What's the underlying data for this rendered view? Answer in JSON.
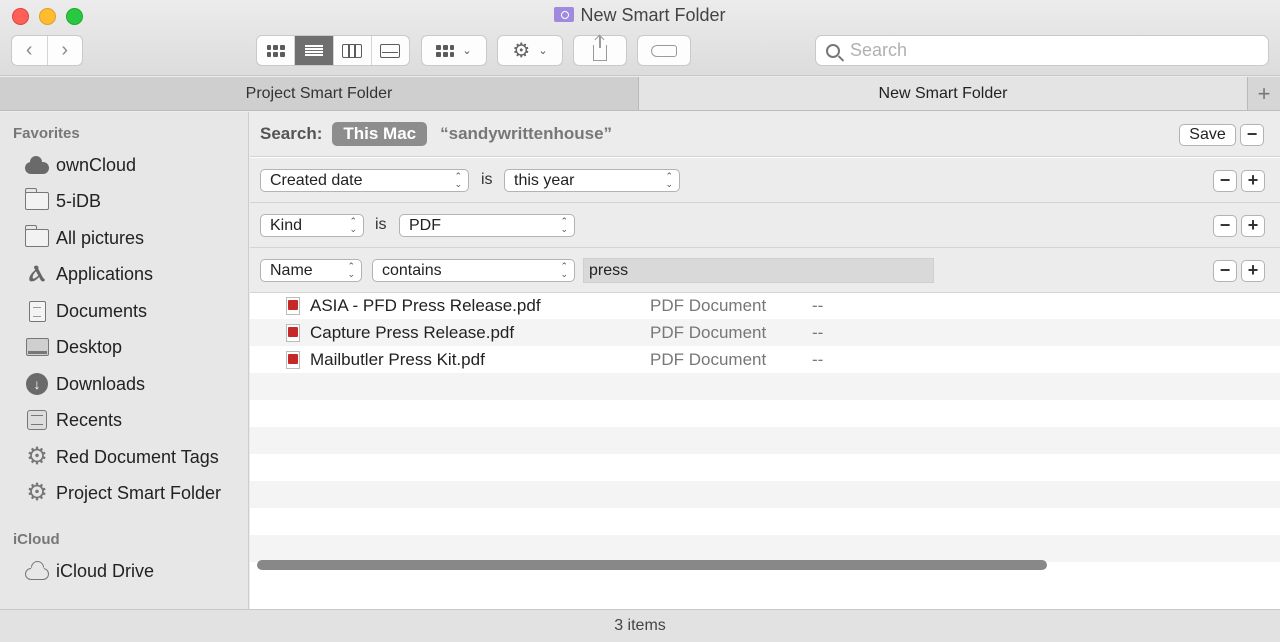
{
  "window": {
    "title": "New Smart Folder"
  },
  "toolbar": {
    "back_icon": "chevron-left-icon",
    "forward_icon": "chevron-right-icon",
    "view_modes": [
      "icons",
      "list",
      "columns",
      "gallery"
    ],
    "active_view": "list",
    "search": {
      "placeholder": "Search",
      "value": ""
    }
  },
  "tabs": [
    {
      "label": "Project Smart Folder",
      "active": false
    },
    {
      "label": "New Smart Folder",
      "active": true
    }
  ],
  "sidebar": {
    "sections": [
      {
        "title": "Favorites",
        "items": [
          {
            "label": "ownCloud",
            "icon": "cloud-icon"
          },
          {
            "label": "5-iDB",
            "icon": "folder-icon"
          },
          {
            "label": "All pictures",
            "icon": "folder-icon"
          },
          {
            "label": "Applications",
            "icon": "applications-icon"
          },
          {
            "label": "Documents",
            "icon": "document-icon"
          },
          {
            "label": "Desktop",
            "icon": "desktop-icon"
          },
          {
            "label": "Downloads",
            "icon": "downloads-icon"
          },
          {
            "label": "Recents",
            "icon": "recents-icon"
          },
          {
            "label": "Red Document Tags",
            "icon": "gear-icon"
          },
          {
            "label": "Project Smart Folder",
            "icon": "gear-icon"
          }
        ]
      },
      {
        "title": "iCloud",
        "items": [
          {
            "label": "iCloud Drive",
            "icon": "icloud-icon"
          }
        ]
      }
    ]
  },
  "search_bar": {
    "label": "Search:",
    "scope_active": "This Mac",
    "scope_other": "“sandywrittenhouse”",
    "save_label": "Save",
    "minus_label": "−",
    "plus_label": "+"
  },
  "rules": [
    {
      "attribute": "Created date",
      "operator_text": "is",
      "value": "this year"
    },
    {
      "attribute": "Kind",
      "operator_text": "is",
      "value": "PDF"
    },
    {
      "attribute": "Name",
      "operator": "contains",
      "value": "press"
    }
  ],
  "results": [
    {
      "name": "ASIA - PFD Press Release.pdf",
      "kind": "PDF Document",
      "size": "--"
    },
    {
      "name": "Capture Press Release.pdf",
      "kind": "PDF Document",
      "size": "--"
    },
    {
      "name": "Mailbutler Press Kit.pdf",
      "kind": "PDF Document",
      "size": "--"
    }
  ],
  "status": {
    "item_count": "3 items"
  }
}
